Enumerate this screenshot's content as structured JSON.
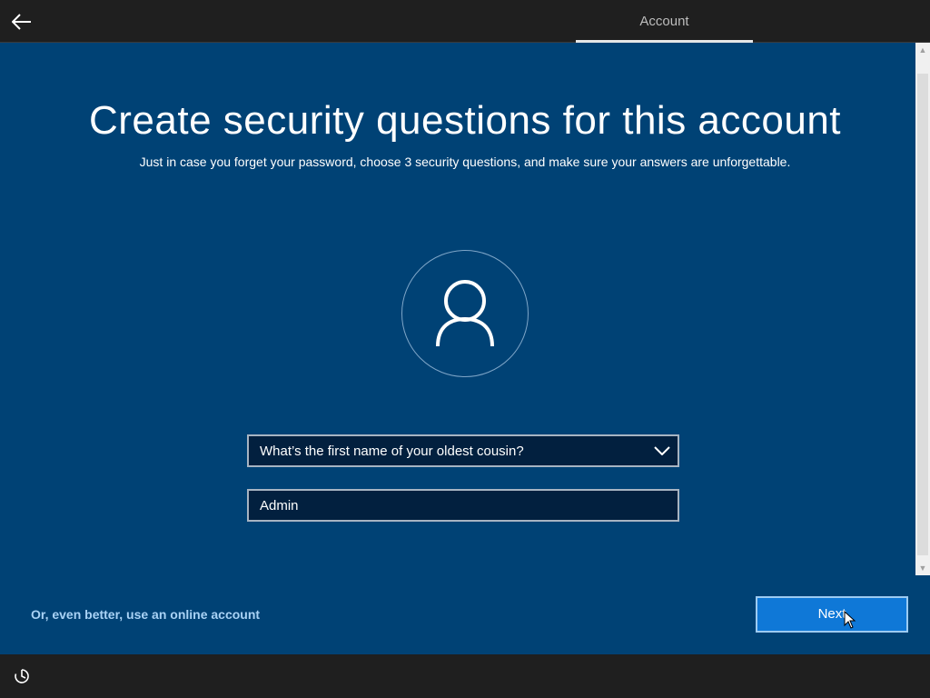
{
  "header": {
    "tab_label": "Account"
  },
  "page": {
    "title": "Create security questions for this account",
    "subtitle": "Just in case you forget your password, choose 3 security questions, and make sure your answers are unforgettable."
  },
  "form": {
    "question_selected": "What’s the first name of your oldest cousin?",
    "answer_value": "Admin"
  },
  "footer": {
    "online_account_link": "Or, even better, use an online account",
    "next_label": "Next"
  },
  "icons": {
    "back": "back-arrow-icon",
    "avatar": "user-icon",
    "dropdown": "chevron-down-icon",
    "accessibility": "ease-of-access-icon"
  },
  "colors": {
    "background": "#004275",
    "topbar": "#1f1f1f",
    "button": "#0f78d7",
    "link": "#a9d2f5"
  }
}
